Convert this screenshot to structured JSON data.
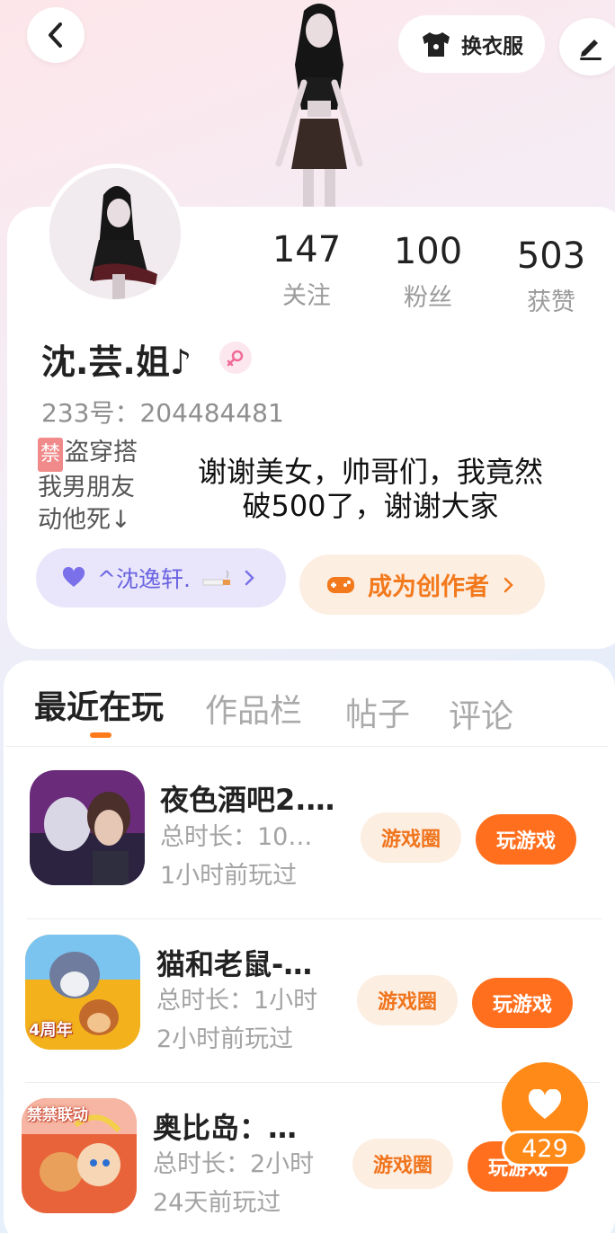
{
  "header": {
    "outfit_label": "换衣服"
  },
  "profile": {
    "stats": [
      {
        "value": "147",
        "label": "关注"
      },
      {
        "value": "100",
        "label": "粉丝"
      },
      {
        "value": "503",
        "label": "获赞"
      }
    ],
    "name": "沈.芸.姐♪",
    "uid": "233号：204484481",
    "bio_tag": "禁",
    "bio_line1": "盗穿搭",
    "bio_line2": "我男朋友",
    "bio_line3": "动他死↓",
    "caption": "谢谢美女，帅哥们，我竟然破500了，谢谢大家",
    "partner_label": "^沈逸轩.",
    "creator_label": "成为创作者",
    "colors": {
      "accent": "#ff6f1e",
      "partner": "#6a63e0"
    }
  },
  "tabs": [
    {
      "label": "最近在玩"
    },
    {
      "label": "作品栏"
    },
    {
      "label": "帖子"
    },
    {
      "label": "评论"
    }
  ],
  "games": [
    {
      "title": "夜色酒吧2.…",
      "duration": "总时长：10…",
      "last_played": "1小时前玩过",
      "circle_label": "游戏圈",
      "play_label": "玩游戏"
    },
    {
      "title": "猫和老鼠-…",
      "duration": "总时长：1小时",
      "last_played": "2小时前玩过",
      "circle_label": "游戏圈",
      "play_label": "玩游戏",
      "icon_badge": "4周年"
    },
    {
      "title": "奥比岛：…",
      "duration": "总时长：2小时",
      "last_played": "24天前玩过",
      "circle_label": "游戏圈",
      "play_label": "玩游戏",
      "icon_badge": "禁禁联动"
    }
  ],
  "like": {
    "count": "429"
  }
}
